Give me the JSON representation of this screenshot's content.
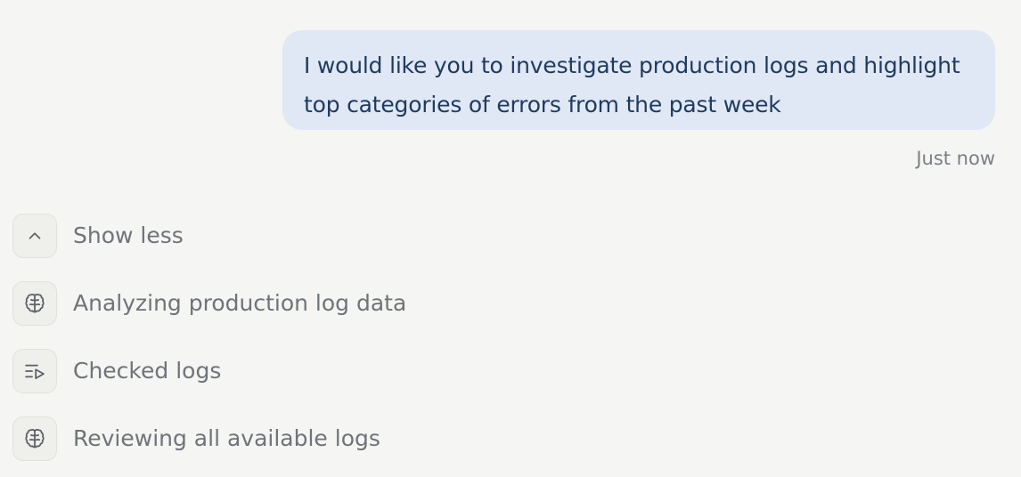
{
  "message": {
    "text": "I would like you to investigate production logs and highlight top categories of errors from the past week",
    "timestamp": "Just now"
  },
  "steps": [
    {
      "icon": "chevron-up-icon",
      "label": "Show less"
    },
    {
      "icon": "brain-icon",
      "label": "Analyzing production log data"
    },
    {
      "icon": "log-list-icon",
      "label": "Checked logs"
    },
    {
      "icon": "brain-icon",
      "label": "Reviewing all available logs"
    }
  ]
}
